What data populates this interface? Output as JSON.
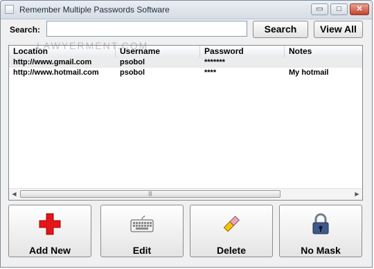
{
  "window": {
    "title": "Remember Multiple Passwords Software",
    "controls": {
      "minimize": "▭",
      "maximize": "□",
      "close": "✕"
    }
  },
  "search": {
    "label": "Search:",
    "value": "",
    "button": "Search",
    "view_all": "View All"
  },
  "watermark": "LAWYERMENT.COM",
  "table": {
    "columns": [
      "Location",
      "Username",
      "Password",
      "Notes"
    ],
    "rows": [
      {
        "location": "http://www.gmail.com",
        "username": "psobol",
        "password": "*******",
        "notes": ""
      },
      {
        "location": "http://www.hotmail.com",
        "username": "psobol",
        "password": "****",
        "notes": "My hotmail"
      }
    ],
    "scroll": {
      "left_icon": "◀",
      "right_icon": "▶",
      "thumb_grip": "|||"
    }
  },
  "actions": {
    "add_new": {
      "label": "Add New",
      "icon": "red-plus-icon"
    },
    "edit": {
      "label": "Edit",
      "icon": "keyboard-icon"
    },
    "delete": {
      "label": "Delete",
      "icon": "eraser-icon"
    },
    "no_mask": {
      "label": "No Mask",
      "icon": "padlock-icon"
    }
  },
  "colors": {
    "add_icon": "#e3141a",
    "close_button": "#c5412a",
    "selected_row": "#ececec"
  }
}
